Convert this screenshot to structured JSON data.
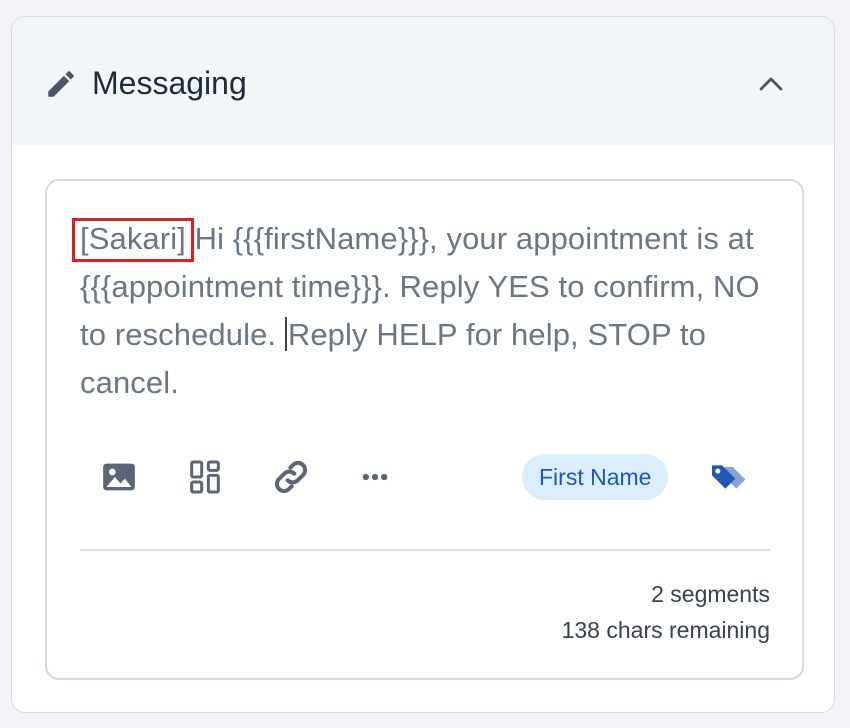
{
  "panel": {
    "title": "Messaging",
    "header_icon": "pencil-icon",
    "toggle_icon": "chevron-up-icon"
  },
  "editor": {
    "brand_tag": "[Sakari]",
    "message_before_cursor": " Hi {{{firstName}}}, your appointment is at {{{appointment time}}}.  Reply YES to confirm, NO to reschedule.  ",
    "message_after_cursor": "Reply HELP for help, STOP to cancel."
  },
  "toolbar": {
    "icons": [
      "image-icon",
      "template-icon",
      "link-icon",
      "more-icon",
      "tag-icon"
    ],
    "first_name_chip": "First Name"
  },
  "footer": {
    "segments": "2 segments",
    "chars_remaining": "138 chars remaining"
  },
  "colors": {
    "highlight": "#e11d1d",
    "chip_bg": "#d9edfb",
    "accent": "#1f58b5"
  }
}
